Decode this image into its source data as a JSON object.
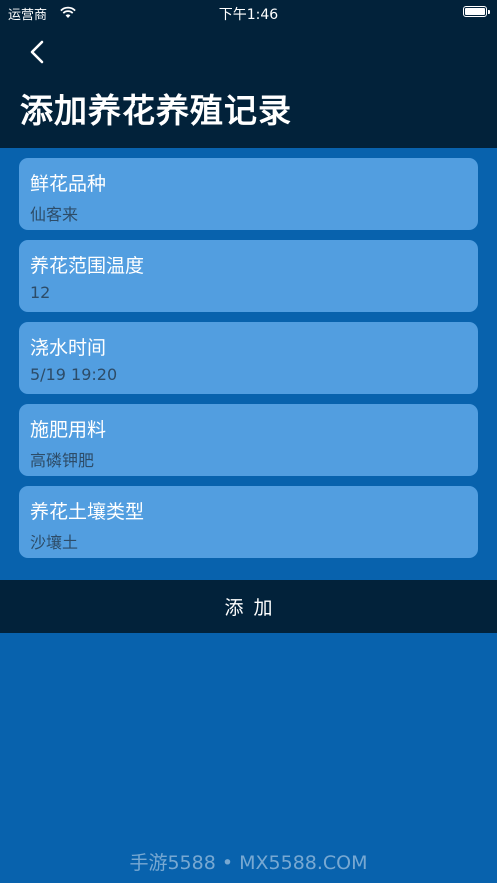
{
  "status_bar": {
    "carrier": "运营商",
    "time": "下午1:46"
  },
  "header": {
    "title": "添加养花养殖记录"
  },
  "fields": [
    {
      "label": "鲜花品种",
      "value": "仙客来"
    },
    {
      "label": "养花范围温度",
      "value": "12"
    },
    {
      "label": "浇水时间",
      "value": "5/19  19:20"
    },
    {
      "label": "施肥用料",
      "value": "高磷钾肥"
    },
    {
      "label": "养花土壤类型",
      "value": "沙壤土"
    }
  ],
  "actions": {
    "add_label": "添加"
  },
  "watermark": "手游5588 • MX5588.COM",
  "colors": {
    "header_bg": "#02223a",
    "page_bg": "#0862ad",
    "field_bg": "#529ee0",
    "value_text": "#2d4c68"
  },
  "icons": {
    "back": "chevron-left-icon",
    "wifi": "wifi-icon",
    "battery": "battery-icon"
  }
}
